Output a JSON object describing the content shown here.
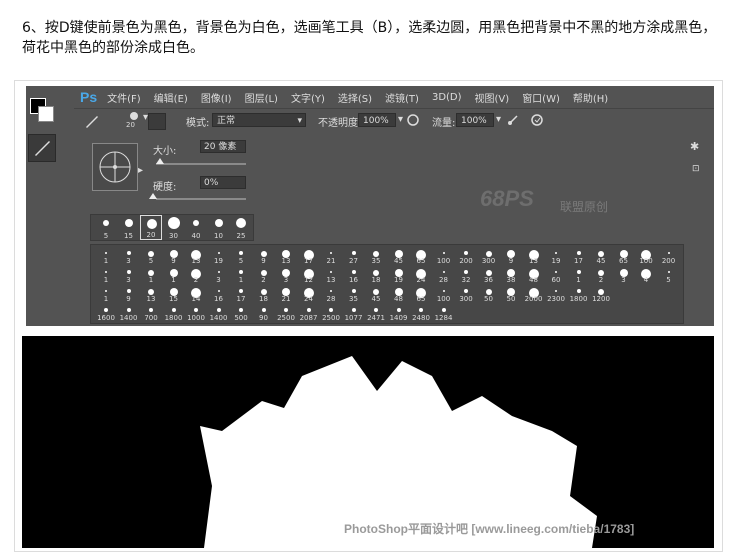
{
  "instruction": "6、按D键使前景色为黑色，背景色为白色，选画笔工具（B），选柔边圆，用黑色把背景中不黑的地方涂成黑色，荷花中黑色的部份涂成白色。",
  "ps": {
    "logo": "Ps",
    "menu": [
      "文件(F)",
      "编辑(E)",
      "图像(I)",
      "图层(L)",
      "文字(Y)",
      "选择(S)",
      "滤镜(T)",
      "3D(D)",
      "视图(V)",
      "窗口(W)",
      "帮助(H)"
    ],
    "options": {
      "brush_size": "20",
      "mode_label": "模式:",
      "mode_value": "正常",
      "opacity_label": "不透明度:",
      "opacity_value": "100%",
      "flow_label": "流量:",
      "flow_value": "100%"
    },
    "picker": {
      "size_label": "大小:",
      "size_value": "20 像素",
      "hardness_label": "硬度:",
      "hardness_value": "0%"
    },
    "presets": [
      "5",
      "15",
      "20",
      "30",
      "40",
      "10",
      "25"
    ],
    "brush_rows": [
      [
        "1",
        "3",
        "5",
        "9",
        "13",
        "19",
        "5",
        "9",
        "13",
        "17",
        "21",
        "27",
        "35",
        "45",
        "65",
        "100",
        "200",
        "300",
        "9",
        "13",
        "19",
        "17",
        "45",
        "65",
        "100",
        "200"
      ],
      [
        "1",
        "3",
        "1",
        "1",
        "2",
        "3",
        "1",
        "2",
        "3",
        "12",
        "13",
        "16",
        "18",
        "19",
        "24",
        "28",
        "32",
        "36",
        "38",
        "48",
        "60",
        "1",
        "2",
        "3",
        "4",
        "5"
      ],
      [
        "1",
        "9",
        "13",
        "15",
        "14",
        "16",
        "17",
        "18",
        "21",
        "24",
        "28",
        "35",
        "45",
        "48",
        "65",
        "100",
        "300",
        "50",
        "50",
        "2000",
        "2300",
        "1800",
        "1200"
      ],
      [
        "1600",
        "1400",
        "700",
        "1800",
        "1000",
        "1400",
        "500",
        "90",
        "2500",
        "2087",
        "2500",
        "1077",
        "2471",
        "1409",
        "2480",
        "1284"
      ]
    ]
  },
  "watermark": {
    "logo": "68PS",
    "text": "联盟原创"
  },
  "credit": "PhotoShop平面设计吧 [www.lineeg.com/tieba/1783]"
}
